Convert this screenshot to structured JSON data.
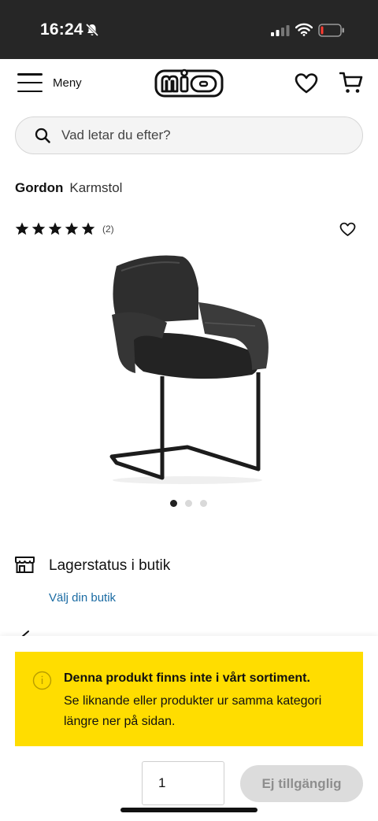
{
  "status_bar": {
    "time": "16:24",
    "icons": [
      "bell-slash-icon",
      "signal-icon",
      "wifi-icon",
      "battery-low-icon"
    ]
  },
  "header": {
    "menu_label": "Meny",
    "logo_text": "mio",
    "icons": [
      "hamburger-icon",
      "heart-icon",
      "cart-icon"
    ]
  },
  "search": {
    "placeholder": "Vad letar du efter?"
  },
  "product": {
    "brand": "Gordon",
    "type": "Karmstol",
    "rating_stars": 5,
    "review_count": "(2)",
    "image_count": 3,
    "active_image": 1
  },
  "stock": {
    "title": "Lagerstatus i butik",
    "link": "Välj din butik"
  },
  "notice": {
    "title": "Denna produkt finns inte i vårt sortiment.",
    "text": "Se liknande eller produkter ur samma kategori längre ner på sidan."
  },
  "purchase": {
    "quantity": "1",
    "button_label": "Ej tillgänglig"
  },
  "colors": {
    "notice_bg": "#ffdd00",
    "link": "#1a6ba3",
    "status_bar": "#262626",
    "disabled_button": "#dcdcdc"
  }
}
